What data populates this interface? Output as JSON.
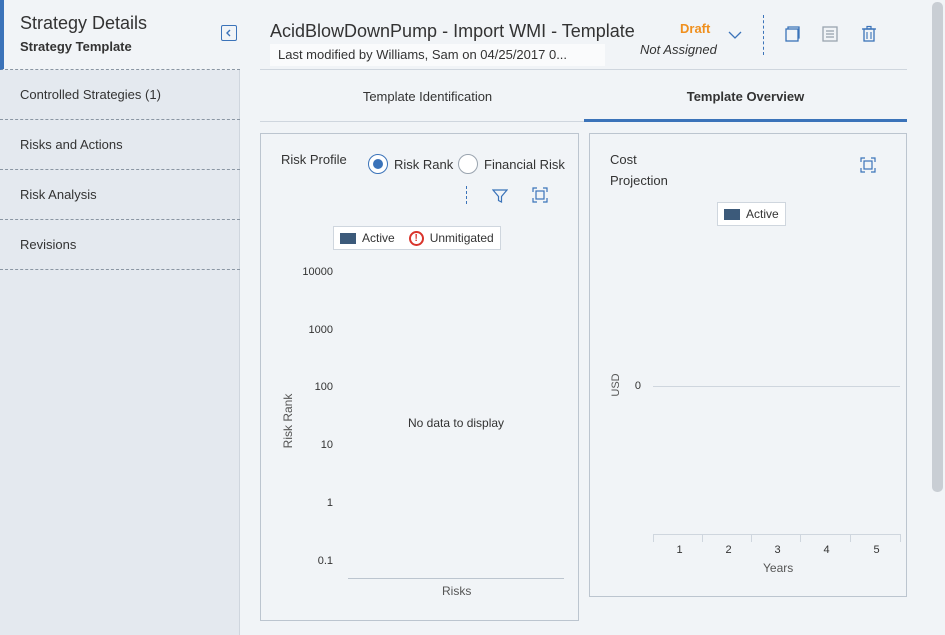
{
  "sidebar": {
    "title": "Strategy Details",
    "subtitle": "Strategy Template",
    "items": [
      {
        "label": "Controlled Strategies (1)"
      },
      {
        "label": "Risks and Actions"
      },
      {
        "label": "Risk Analysis"
      },
      {
        "label": "Revisions"
      }
    ]
  },
  "header": {
    "title": "AcidBlowDownPump - Import WMI - Template",
    "modified": "Last modified by Williams, Sam on 04/25/2017 0...",
    "state": "Draft",
    "assigned": "Not Assigned"
  },
  "tabs": [
    {
      "label": "Template Identification",
      "active": false
    },
    {
      "label": "Template Overview",
      "active": true
    }
  ],
  "risk_profile": {
    "title": "Risk Profile",
    "options": [
      {
        "label": "Risk Rank",
        "selected": true
      },
      {
        "label": "Financial Risk",
        "selected": false
      }
    ],
    "legend": {
      "active": "Active",
      "unmitigated": "Unmitigated"
    },
    "no_data": "No data to display",
    "chart_data": {
      "type": "scatter",
      "y_scale": "log",
      "ylabel": "Risk Rank",
      "xlabel": "Risks",
      "y_ticks": [
        "10000",
        "1000",
        "100",
        "10",
        "1",
        "0.1"
      ],
      "series": []
    }
  },
  "cost_projection": {
    "title_line1": "Cost",
    "title_line2": "Projection",
    "legend": {
      "active": "Active"
    },
    "chart_data": {
      "type": "line",
      "ylabel": "USD",
      "xlabel": "Years",
      "y_ticks": [
        "0"
      ],
      "x_ticks": [
        "1",
        "2",
        "3",
        "4",
        "5"
      ],
      "series": []
    }
  },
  "colors": {
    "accent": "#3b73b9",
    "draft": "#f0901e",
    "active_series": "#3c5a7a",
    "unmitigated": "#d9342b"
  }
}
